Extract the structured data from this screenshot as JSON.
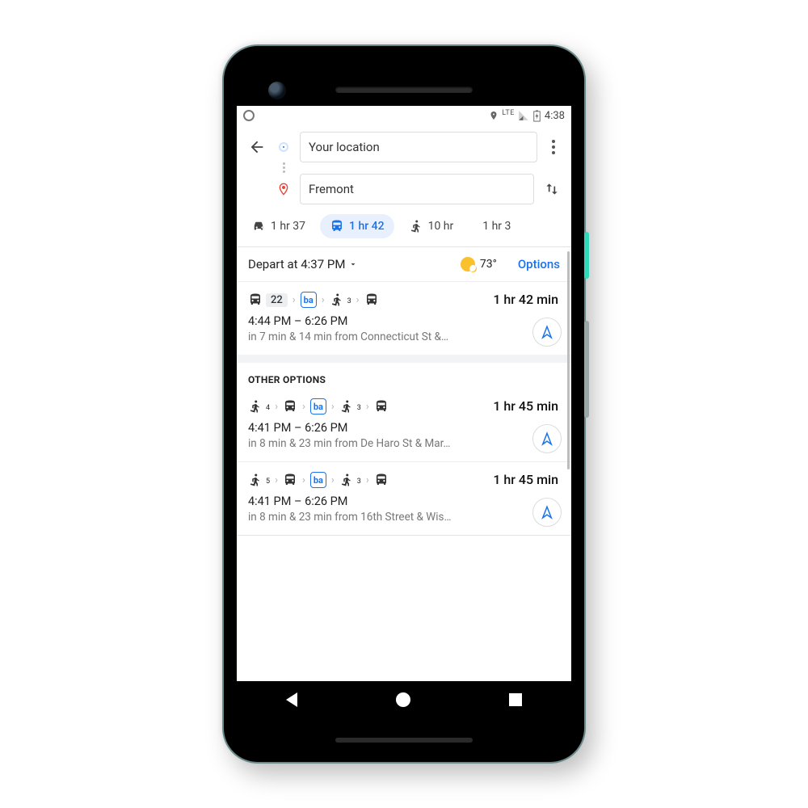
{
  "status": {
    "network": "LTE",
    "time": "4:38"
  },
  "header": {
    "origin": "Your location",
    "destination": "Fremont"
  },
  "modes": {
    "drive": "1 hr 37",
    "transit": "1 hr 42",
    "walk": "10 hr",
    "bike": "1 hr 3"
  },
  "controls": {
    "depart": "Depart at 4:37 PM",
    "temp": "73°",
    "options": "Options"
  },
  "sections": {
    "other": "OTHER OPTIONS"
  },
  "routes": [
    {
      "legs_bus_line": "22",
      "walk_sub": "3",
      "duration": "1 hr 42 min",
      "times": "4:44 PM – 6:26 PM",
      "eta": "in 7 min & 14 min from Connecticut St &…"
    },
    {
      "walk_a": "4",
      "walk_b": "3",
      "duration": "1 hr 45 min",
      "times": "4:41 PM – 6:26 PM",
      "eta": "in 8 min & 23 min from De Haro St & Mar…"
    },
    {
      "walk_a": "5",
      "walk_b": "3",
      "duration": "1 hr 45 min",
      "times": "4:41 PM – 6:26 PM",
      "eta": "in 8 min & 23 min from 16th Street & Wis…"
    }
  ]
}
